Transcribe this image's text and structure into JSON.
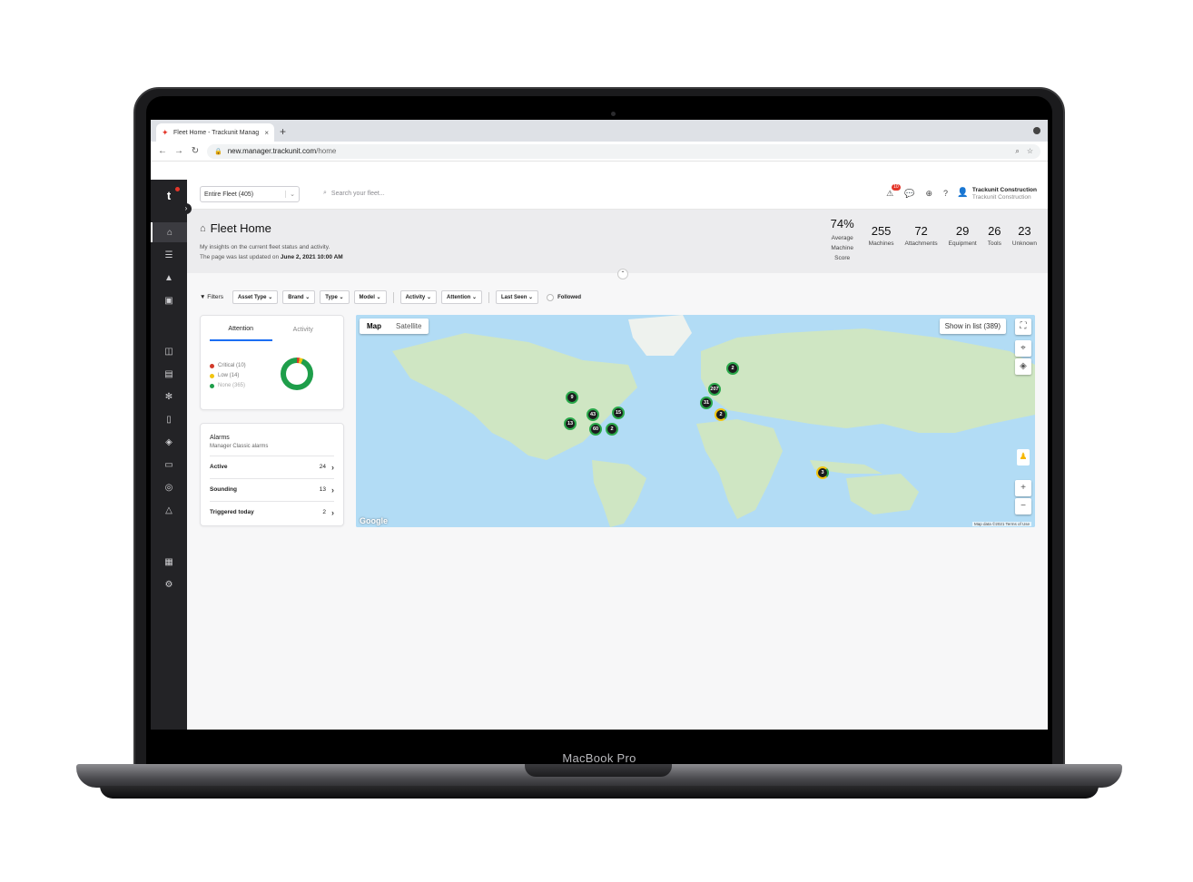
{
  "device": {
    "model": "MacBook Pro"
  },
  "browser": {
    "tab_title": "Fleet Home - Trackunit Manag",
    "url_domain": "new.manager.trackunit.com",
    "url_path": "/home"
  },
  "topbar": {
    "fleet_select": "Entire Fleet (405)",
    "search_placeholder": "Search your fleet...",
    "notification_count": "10",
    "user_name": "Trackunit Construction",
    "user_org": "Trackunit Construction"
  },
  "header": {
    "title": "Fleet Home",
    "subtitle": "My insights on the current fleet status and activity.",
    "updated_prefix": "The page was last updated on",
    "updated_value": "June 2, 2021 10:00 AM",
    "stats": [
      {
        "num": "74%",
        "label": "Average Machine Score"
      },
      {
        "num": "255",
        "label": "Machines"
      },
      {
        "num": "72",
        "label": "Attachments"
      },
      {
        "num": "29",
        "label": "Equipment"
      },
      {
        "num": "26",
        "label": "Tools"
      },
      {
        "num": "23",
        "label": "Unknown"
      }
    ]
  },
  "filters": {
    "label": "Filters",
    "chips": [
      "Asset Type",
      "Brand",
      "Type",
      "Model",
      "Activity",
      "Attention",
      "Last Seen"
    ],
    "followed": "Followed"
  },
  "attention_card": {
    "tabs": [
      "Attention",
      "Activity"
    ],
    "active_tab": "Attention",
    "legend": [
      {
        "label": "Critical (10)",
        "color": "#d23a2a",
        "value": 10
      },
      {
        "label": "Low (14)",
        "color": "#f1c40f",
        "value": 14
      },
      {
        "label": "None (365)",
        "color": "#1e9e4a",
        "value": 365
      }
    ]
  },
  "alarms_card": {
    "title": "Alarms",
    "subtitle": "Manager Classic alarms",
    "rows": [
      {
        "label": "Active",
        "count": "24"
      },
      {
        "label": "Sounding",
        "count": "13"
      },
      {
        "label": "Triggered today",
        "count": "2"
      }
    ]
  },
  "map": {
    "type_options": [
      "Map",
      "Satellite"
    ],
    "active_type": "Map",
    "show_in_list": "Show in list (389)",
    "credit": "Map data ©2021   Terms of Use",
    "provider": "Google",
    "clusters": [
      {
        "count": "9",
        "status": "ok"
      },
      {
        "count": "43",
        "status": "ok"
      },
      {
        "count": "15",
        "status": "ok"
      },
      {
        "count": "13",
        "status": "ok"
      },
      {
        "count": "60",
        "status": "ok"
      },
      {
        "count": "2",
        "status": "ok"
      },
      {
        "count": "2",
        "status": "ok"
      },
      {
        "count": "207",
        "status": "ok"
      },
      {
        "count": "31",
        "status": "ok"
      },
      {
        "count": "2",
        "status": "warn"
      },
      {
        "count": "3",
        "status": "warn"
      }
    ]
  }
}
